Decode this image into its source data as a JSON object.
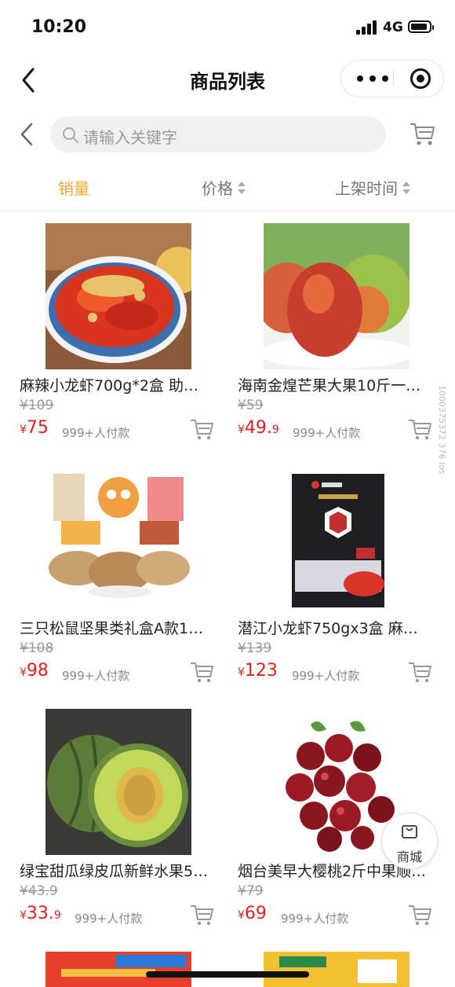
{
  "status": {
    "time": "10:20",
    "network": "4G"
  },
  "nav": {
    "title": "商品列表"
  },
  "search": {
    "placeholder": "请输入关键字"
  },
  "sort_tabs": [
    {
      "label": "销量",
      "active": true
    },
    {
      "label": "价格",
      "active": false
    },
    {
      "label": "上架时间",
      "active": false
    }
  ],
  "products": [
    {
      "name": "麻辣小龙虾700g*2盒 助…",
      "original_price": "¥109",
      "price_currency": "¥",
      "price_int": "75",
      "price_dec": "",
      "sales": "999+人付款"
    },
    {
      "name": "海南金煌芒果大果10斤一…",
      "original_price": "¥59",
      "price_currency": "¥",
      "price_int": "49.",
      "price_dec": "9",
      "sales": "999+人付款"
    },
    {
      "name": "三只松鼠坚果类礼盒A款1…",
      "original_price": "¥108",
      "price_currency": "¥",
      "price_int": "98",
      "price_dec": "",
      "sales": "999+人付款"
    },
    {
      "name": "潜江小龙虾750gx3盒 麻…",
      "original_price": "¥139",
      "price_currency": "¥",
      "price_int": "123",
      "price_dec": "",
      "sales": "999+人付款"
    },
    {
      "name": "绿宝甜瓜绿皮瓜新鲜水果5…",
      "original_price": "¥43.9",
      "price_currency": "¥",
      "price_int": "33.",
      "price_dec": "9",
      "sales": "999+人付款"
    },
    {
      "name": "烟台美早大樱桃2斤中果顺…",
      "original_price": "¥79",
      "price_currency": "¥",
      "price_int": "69",
      "price_dec": "",
      "sales": "999+人付款"
    }
  ],
  "side_text": "1000375372 376 ios",
  "float_button": {
    "label": "商城"
  },
  "colors": {
    "accent": "#f5a623",
    "price": "#e02020"
  }
}
